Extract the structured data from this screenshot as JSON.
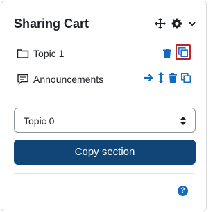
{
  "block": {
    "title": "Sharing Cart"
  },
  "header_icons": [
    "move-icon",
    "gear-icon",
    "chevron-down-icon"
  ],
  "items": [
    {
      "label": "Topic 1",
      "icon": "folder-icon",
      "actions": [
        "trash-icon",
        "copy-icon"
      ]
    },
    {
      "label": "Announcements",
      "icon": "forum-icon",
      "actions": [
        "arrow-right-icon",
        "move-vertical-icon",
        "trash-icon",
        "copy-icon"
      ]
    }
  ],
  "section_select": {
    "selected": "Topic 0"
  },
  "copy_button": {
    "label": "Copy section"
  },
  "help": {
    "glyph": "?"
  },
  "colors": {
    "accent": "#0f6cbf",
    "button_bg": "#0f4677",
    "highlight": "#c0202a",
    "text": "#1d2125"
  }
}
